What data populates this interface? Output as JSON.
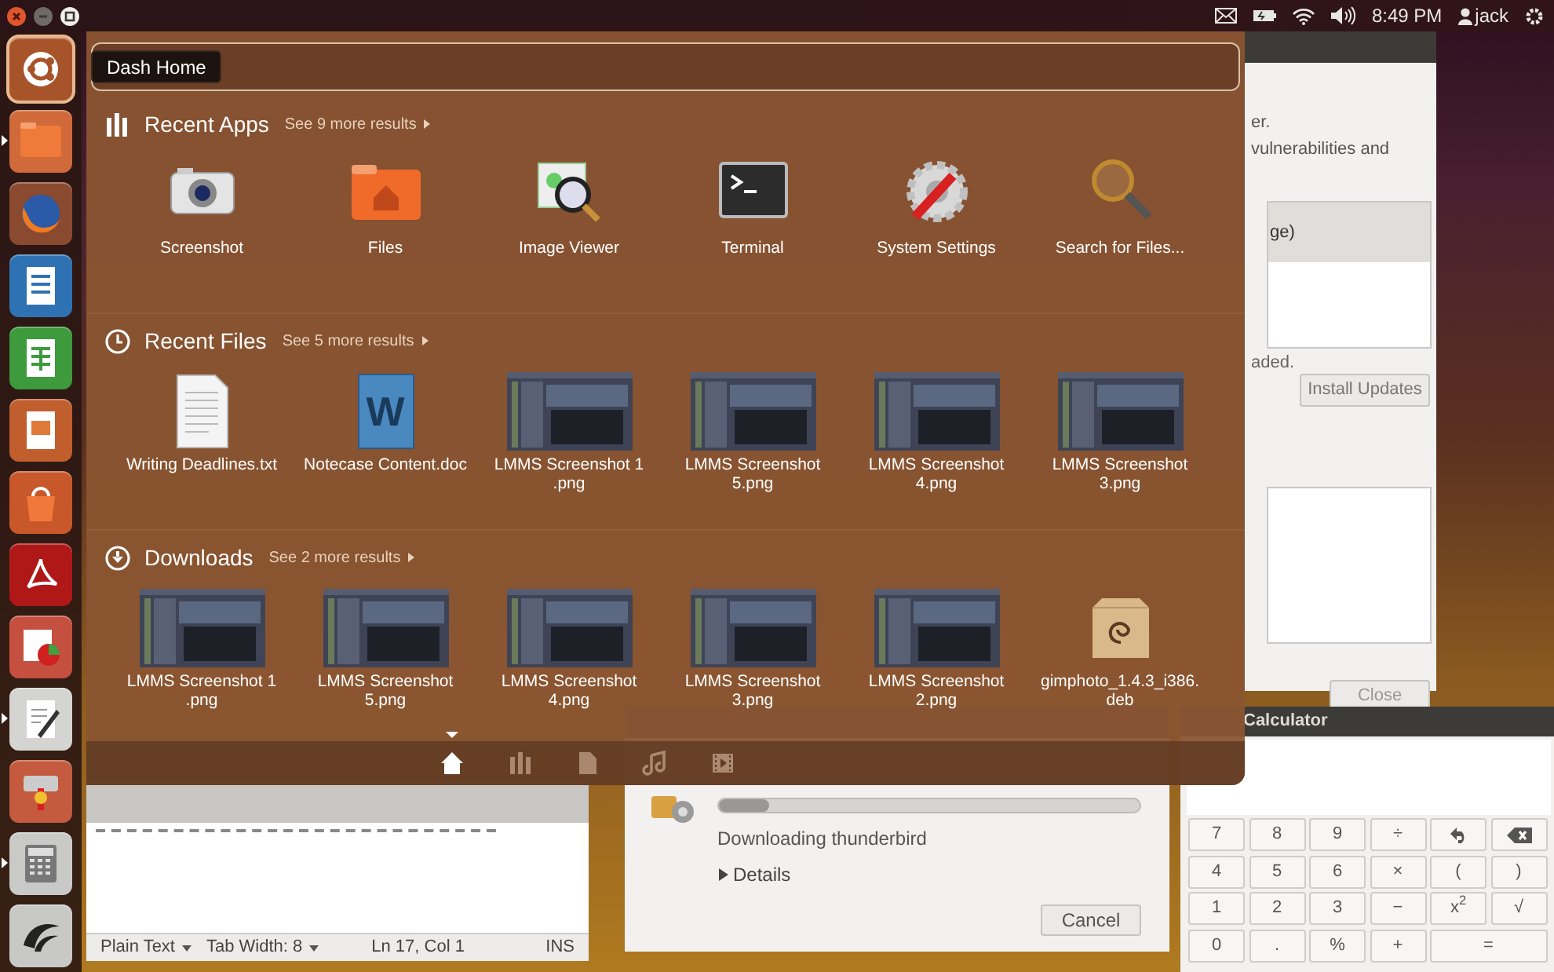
{
  "top_panel": {
    "window_controls": [
      {
        "kind": "close"
      },
      {
        "kind": "minimize"
      },
      {
        "kind": "maximize"
      }
    ],
    "indicators": [
      {
        "kind": "mail"
      },
      {
        "kind": "battery"
      },
      {
        "kind": "wifi"
      },
      {
        "kind": "volume"
      }
    ],
    "clock": "8:49 PM",
    "user": "jack"
  },
  "launcher": {
    "items": [
      {
        "kind": "dash",
        "running": false,
        "selected": true
      },
      {
        "kind": "files",
        "running": true,
        "selected": false
      },
      {
        "kind": "browser",
        "running": false,
        "selected": false
      },
      {
        "kind": "document",
        "running": false,
        "selected": false
      },
      {
        "kind": "spreadsheet",
        "running": false,
        "selected": false
      },
      {
        "kind": "presentation",
        "running": false,
        "selected": false
      },
      {
        "kind": "software-center",
        "running": false,
        "selected": false
      },
      {
        "kind": "pdf",
        "running": false,
        "selected": false
      },
      {
        "kind": "chart",
        "running": false,
        "selected": false
      },
      {
        "kind": "text-editor",
        "running": true,
        "selected": false
      },
      {
        "kind": "installer",
        "running": false,
        "selected": false
      },
      {
        "kind": "calculator",
        "running": true,
        "selected": false
      },
      {
        "kind": "app",
        "running": false,
        "selected": false
      }
    ]
  },
  "dash": {
    "tooltip": "Dash Home",
    "sections": [
      {
        "kind": "apps",
        "title": "Recent Apps",
        "more": "See 9 more results",
        "items": [
          {
            "kind": "camera",
            "label": "Screenshot"
          },
          {
            "kind": "home-folder",
            "label": "Files"
          },
          {
            "kind": "image-viewer",
            "label": "Image Viewer"
          },
          {
            "kind": "terminal",
            "label": "Terminal"
          },
          {
            "kind": "settings",
            "label": "System Settings"
          },
          {
            "kind": "search",
            "label": "Search for Files..."
          }
        ]
      },
      {
        "kind": "recent",
        "title": "Recent Files",
        "more": "See 5 more results",
        "items": [
          {
            "kind": "text-doc",
            "label": "Writing Deadlines.txt"
          },
          {
            "kind": "word-doc",
            "label": "Notecase Content.doc",
            "glyph": "W"
          },
          {
            "kind": "image",
            "label": "LMMS Screenshot 1 .png"
          },
          {
            "kind": "image",
            "label": "LMMS Screenshot 5.png"
          },
          {
            "kind": "image",
            "label": "LMMS Screenshot 4.png"
          },
          {
            "kind": "image",
            "label": "LMMS Screenshot 3.png"
          }
        ]
      },
      {
        "kind": "downloads",
        "title": "Downloads",
        "more": "See 2 more results",
        "items": [
          {
            "kind": "image",
            "label": "LMMS Screenshot 1 .png"
          },
          {
            "kind": "image",
            "label": "LMMS Screenshot 5.png"
          },
          {
            "kind": "image",
            "label": "LMMS Screenshot 4.png"
          },
          {
            "kind": "image",
            "label": "LMMS Screenshot 3.png"
          },
          {
            "kind": "image",
            "label": "LMMS Screenshot 2.png"
          },
          {
            "kind": "package",
            "label": "gimphoto_1.4.3_i386.deb"
          }
        ]
      }
    ],
    "lenses": [
      {
        "kind": "home",
        "selected": true
      },
      {
        "kind": "apps",
        "selected": false
      },
      {
        "kind": "files",
        "selected": false
      },
      {
        "kind": "music",
        "selected": false
      },
      {
        "kind": "video",
        "selected": false
      }
    ]
  },
  "update_window": {
    "lines": [
      "er.",
      "vulnerabilities and"
    ],
    "list_item": "ge)",
    "summary": "aded.",
    "install_button": "Install Updates",
    "close_button": "Close"
  },
  "download_dialog": {
    "level": 0.12,
    "status": "Downloading thunderbird",
    "details": "Details",
    "details_expanded": false,
    "cancel_button": "Cancel"
  },
  "editor": {
    "language": "Plain Text",
    "tab_width": "Tab Width: 8",
    "position": "Ln 17, Col 1",
    "mode": "INS"
  },
  "calculator": {
    "title": "Calculator",
    "keys": [
      {
        "kind": "text",
        "label": "7"
      },
      {
        "kind": "text",
        "label": "8"
      },
      {
        "kind": "text",
        "label": "9"
      },
      {
        "kind": "text",
        "label": "÷"
      },
      {
        "kind": "undo"
      },
      {
        "kind": "backspace"
      },
      {
        "kind": "text",
        "label": "4"
      },
      {
        "kind": "text",
        "label": "5"
      },
      {
        "kind": "text",
        "label": "6"
      },
      {
        "kind": "text",
        "label": "×"
      },
      {
        "kind": "text",
        "label": "("
      },
      {
        "kind": "text",
        "label": ")"
      },
      {
        "kind": "text",
        "label": "1"
      },
      {
        "kind": "text",
        "label": "2"
      },
      {
        "kind": "text",
        "label": "3"
      },
      {
        "kind": "text",
        "label": "−"
      },
      {
        "kind": "text",
        "label": "x$^{2}$"
      },
      {
        "kind": "text",
        "label": "√"
      },
      {
        "kind": "text",
        "label": "0"
      },
      {
        "kind": "text",
        "label": "."
      },
      {
        "kind": "text",
        "label": "%"
      },
      {
        "kind": "text",
        "label": "+"
      },
      {
        "kind": "wide",
        "label": "="
      }
    ]
  }
}
